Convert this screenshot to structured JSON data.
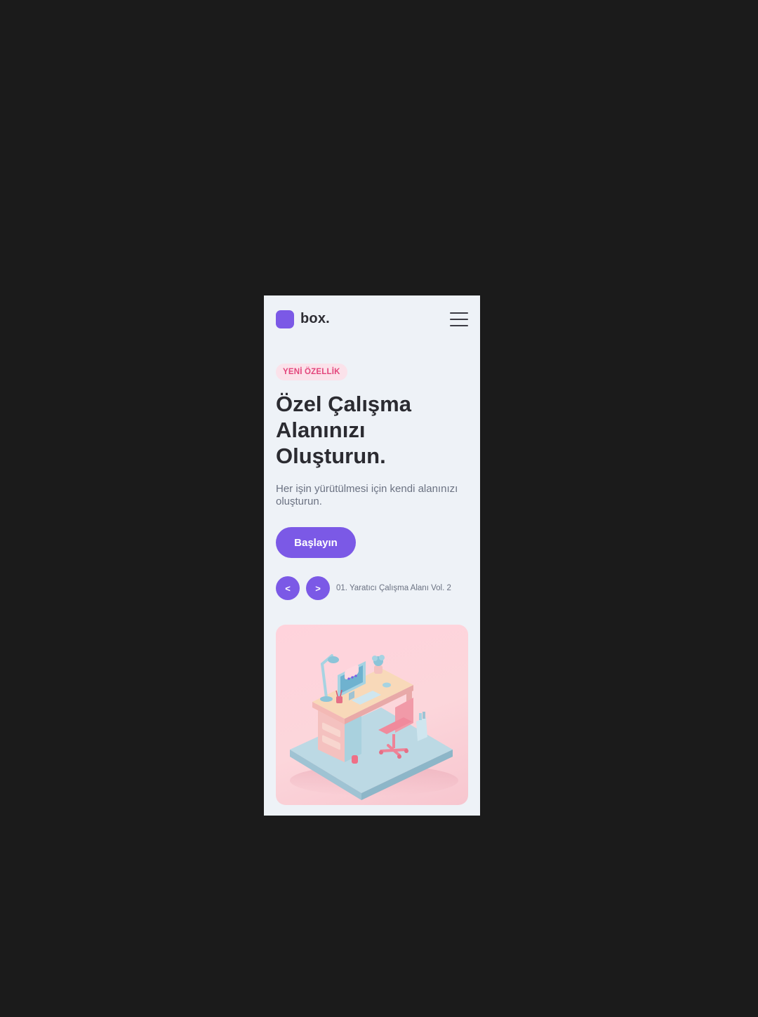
{
  "header": {
    "brand_name": "box.",
    "menu_icon": "hamburger-menu-icon"
  },
  "hero": {
    "badge": "YENİ ÖZELLİK",
    "headline": "Özel Çalışma Alanınızı Oluşturun.",
    "subtitle": "Her işin yürütülmesi için kendi alanınızı oluşturun.",
    "cta_label": "Başlayın"
  },
  "carousel": {
    "prev_label": "<",
    "next_label": ">",
    "caption": "01. Yaratıcı Çalışma Alanı Vol. 2"
  },
  "colors": {
    "accent": "#7b59e6",
    "badge_bg": "#fbe2ea",
    "badge_text": "#e3467c",
    "page_bg": "#eef2f7",
    "frame_bg": "#1b1b1b"
  }
}
